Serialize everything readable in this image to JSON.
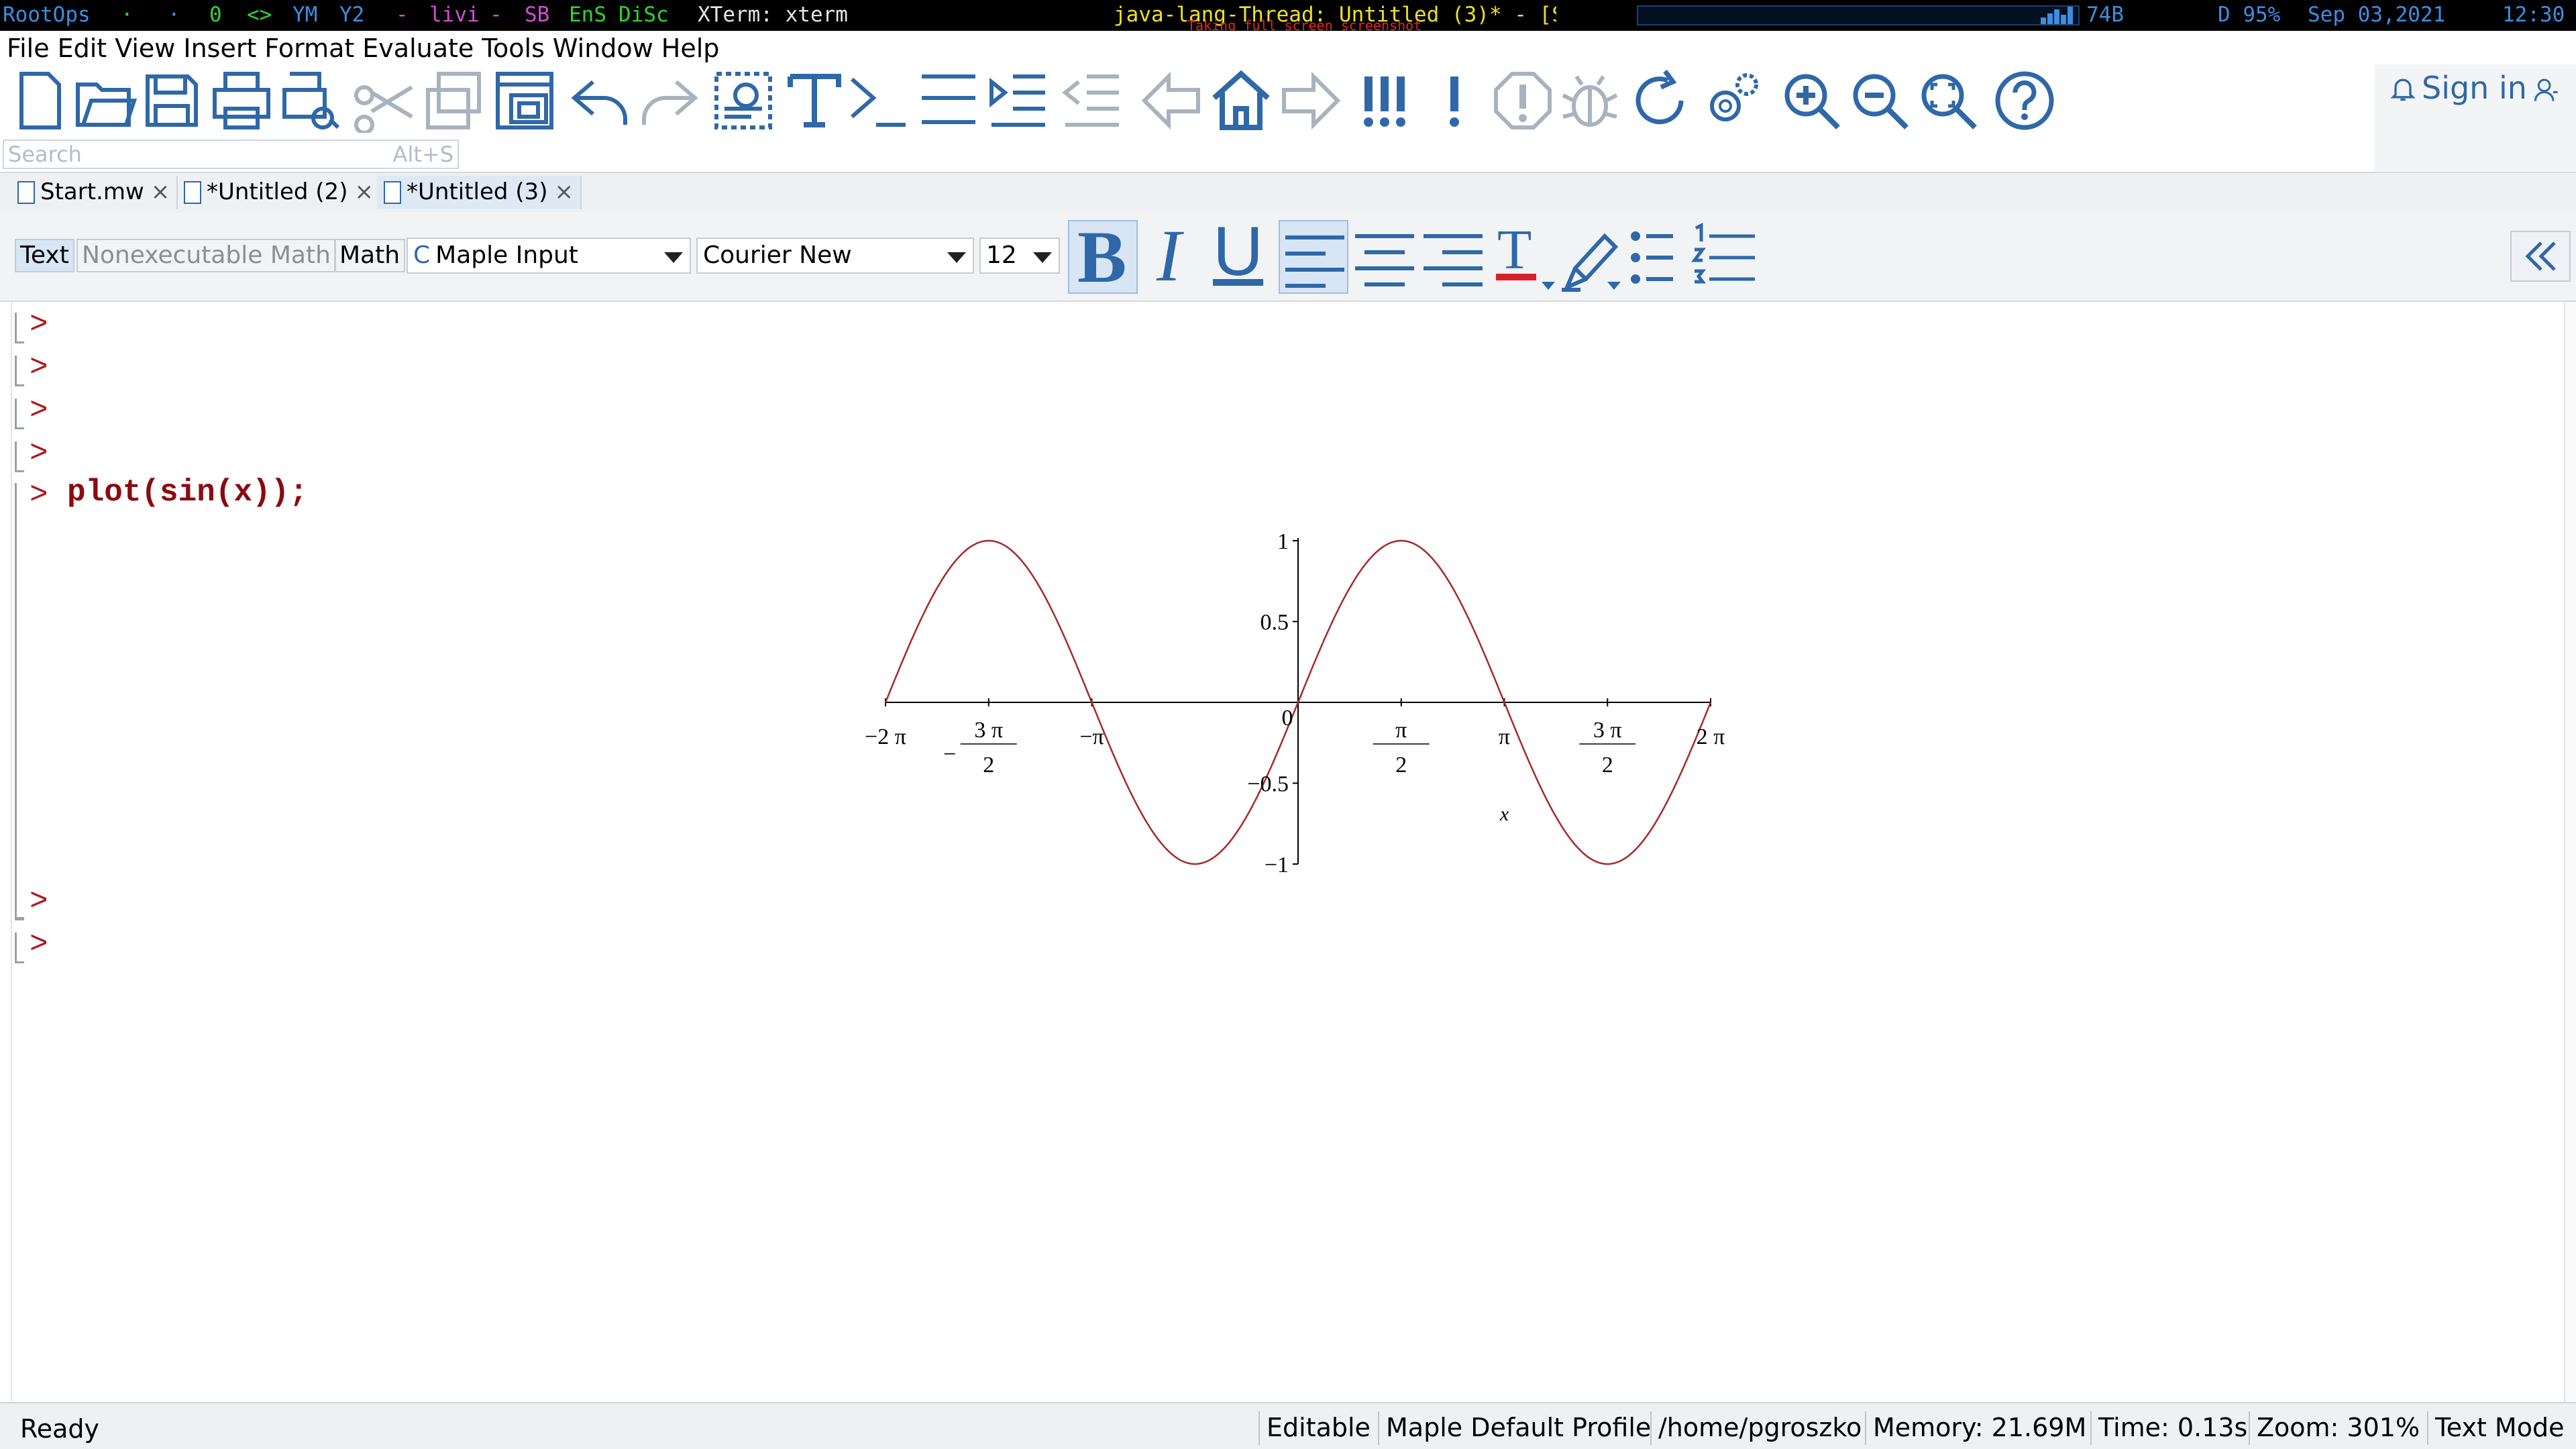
{
  "system_bar": {
    "root_ops": "RootOps",
    "dot1": "·",
    "dot2": "·",
    "zero": "0",
    "arrows": "<>",
    "ym": "YM",
    "y2": "Y2",
    "dash1": "-",
    "livi": "livi",
    "dash2": "-",
    "sb": "SB",
    "ens": "EnS",
    "disc": "DiSc",
    "xterm": "XTerm: xterm",
    "window_title": "java-lang-Thread: Untitled (3)* - [Serve",
    "notice": "Taking full screen screenshot",
    "net": "74B",
    "battery": "D 95%",
    "date": "Sep 03,2021",
    "time": "12:30"
  },
  "menubar": [
    "File",
    "Edit",
    "View",
    "Insert",
    "Format",
    "Evaluate",
    "Tools",
    "Window",
    "Help"
  ],
  "toolbar": {
    "search_placeholder": "Search",
    "search_shortcut": "Alt+S",
    "sign_in": "Sign in",
    "accent": "#2f68a8"
  },
  "tabs": [
    {
      "label": "Start.mw",
      "close": "×"
    },
    {
      "label": "*Untitled (2)",
      "close": "×"
    },
    {
      "label": "*Untitled (3)",
      "close": "×"
    }
  ],
  "format_bar": {
    "mode_text": "Text",
    "mode_nonexec": "Nonexecutable Math",
    "mode_math": "Math",
    "style_icon_glyph": "C",
    "style": "Maple Input",
    "font": "Courier New",
    "size": "12",
    "bold": "B",
    "italic": "I",
    "underline": "U",
    "text_color_glyph": "T"
  },
  "worksheet": {
    "prompt_glyph": ">",
    "command": "plot(sin(x));",
    "prompt_color": "#b0171f"
  },
  "chart_data": {
    "type": "line",
    "function": "sin(x)",
    "series": [
      {
        "color": "#a52a2a"
      }
    ],
    "xlim": [
      -6.2832,
      6.2832
    ],
    "ylim": [
      -1,
      1
    ],
    "xlabel": "x",
    "x_ticks": [
      "−2 π",
      "−3 π/2",
      "−π",
      "0",
      "π/2",
      "π",
      "3 π/2",
      "2 π"
    ],
    "y_ticks": [
      "1",
      "0.5",
      "−0.5",
      "−1"
    ],
    "grid": false
  },
  "status_bar": {
    "ready": "Ready",
    "editable": "Editable",
    "profile": "Maple Default Profile",
    "path": "/home/pgroszko",
    "memory": "Memory: 21.69M",
    "time": "Time: 0.13s",
    "zoom": "Zoom: 301%",
    "mode": "Text Mode"
  }
}
